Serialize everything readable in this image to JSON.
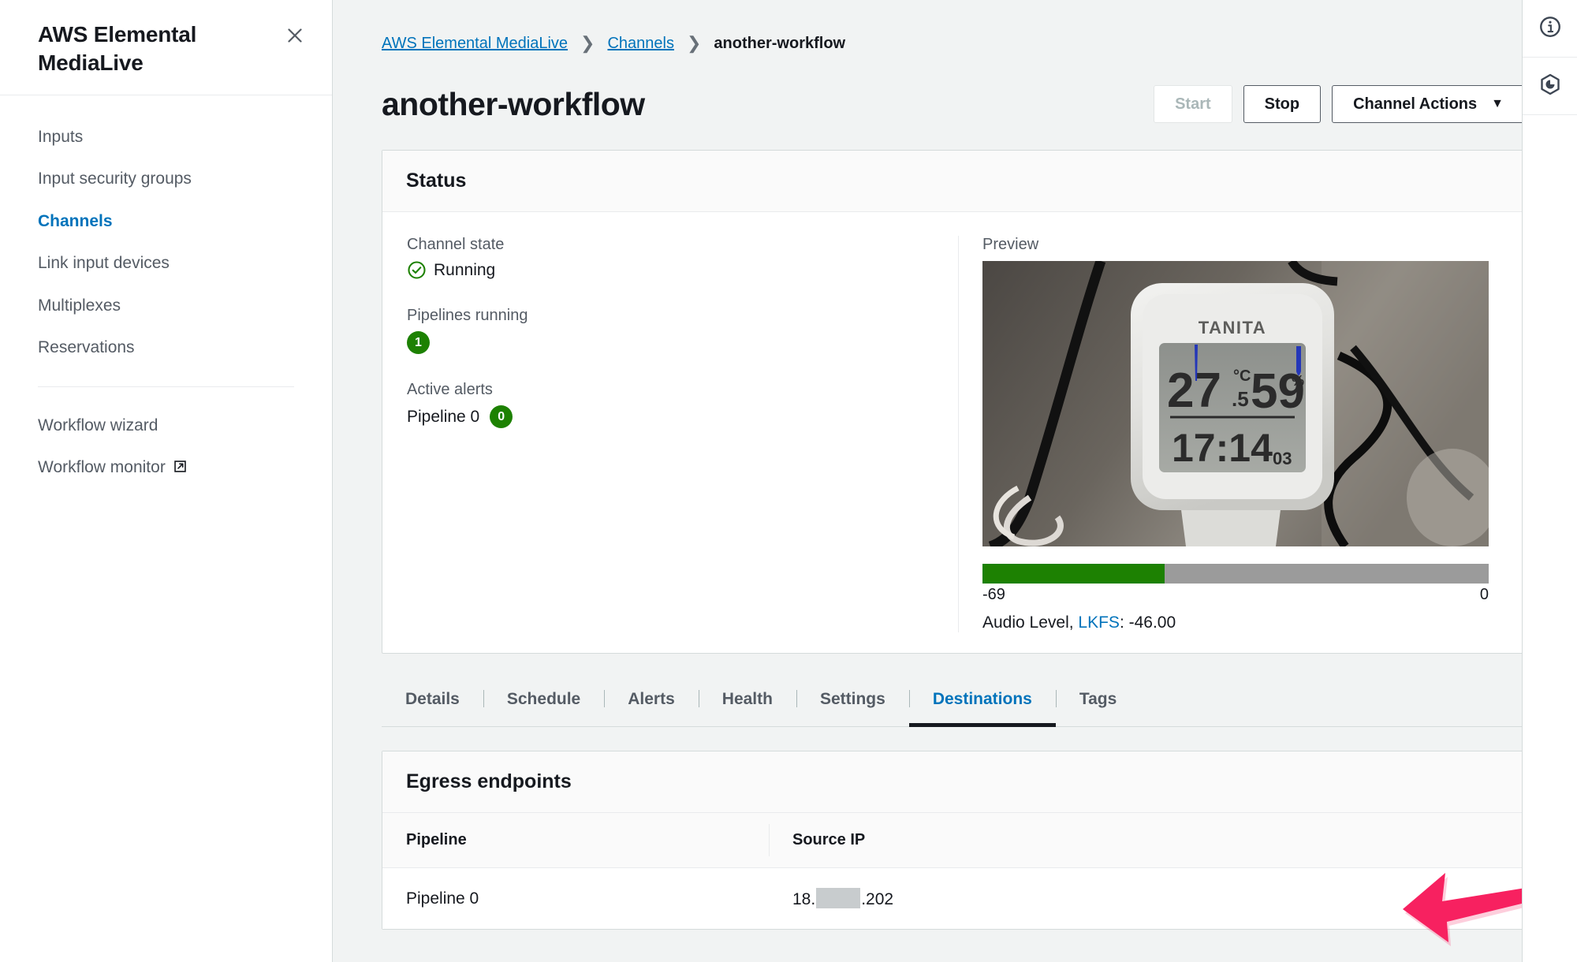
{
  "sidebar": {
    "title": "AWS Elemental MediaLive",
    "close_icon": "close-icon",
    "items": [
      {
        "label": "Inputs",
        "active": false
      },
      {
        "label": "Input security groups",
        "active": false
      },
      {
        "label": "Channels",
        "active": true
      },
      {
        "label": "Link input devices",
        "active": false
      },
      {
        "label": "Multiplexes",
        "active": false
      },
      {
        "label": "Reservations",
        "active": false
      }
    ],
    "secondary_items": [
      {
        "label": "Workflow wizard",
        "external": false
      },
      {
        "label": "Workflow monitor",
        "external": true,
        "icon": "external-link-icon"
      }
    ]
  },
  "breadcrumb": {
    "root": "AWS Elemental MediaLive",
    "section": "Channels",
    "current": "another-workflow"
  },
  "header": {
    "title": "another-workflow",
    "buttons": {
      "start": "Start",
      "stop": "Stop",
      "channel_actions": "Channel Actions",
      "caret": "▼"
    }
  },
  "status_card": {
    "title": "Status",
    "channel_state_label": "Channel state",
    "channel_state_value": "Running",
    "channel_state_icon": "check-circle-icon",
    "pipelines_running_label": "Pipelines running",
    "pipelines_running_value": "1",
    "active_alerts_label": "Active alerts",
    "alert_pipeline_name": "Pipeline 0",
    "alert_pipeline_count": "0",
    "preview_label": "Preview",
    "preview_alt": "live-preview-thumbnail",
    "audio": {
      "min_label": "-69",
      "max_label": "0",
      "fill_percent": 36,
      "caption_prefix": "Audio Level, ",
      "caption_link": "LKFS",
      "caption_suffix": ": -46.00"
    }
  },
  "tabs": [
    {
      "label": "Details",
      "active": false
    },
    {
      "label": "Schedule",
      "active": false
    },
    {
      "label": "Alerts",
      "active": false
    },
    {
      "label": "Health",
      "active": false
    },
    {
      "label": "Settings",
      "active": false
    },
    {
      "label": "Destinations",
      "active": true
    },
    {
      "label": "Tags",
      "active": false
    }
  ],
  "egress": {
    "title": "Egress endpoints",
    "columns": [
      "Pipeline",
      "Source IP"
    ],
    "rows": [
      {
        "pipeline": "Pipeline 0",
        "source_ip_prefix": "18.",
        "source_ip_redacted": true,
        "source_ip_suffix": ".202"
      }
    ]
  },
  "right_rail": [
    {
      "icon": "info-icon"
    },
    {
      "icon": "cloudshell-hexagon-icon"
    }
  ],
  "annotation": {
    "arrow_color": "#f72160",
    "arrow_direction": "left",
    "points_at": "source-ip-cell"
  },
  "colors": {
    "accent_blue": "#0073bb",
    "green": "#1d8102",
    "page_bg": "#f1f3f3",
    "text": "#16191f",
    "muted_text": "#545b64",
    "border": "#d5dbdb",
    "arrow_pink": "#f72160"
  }
}
